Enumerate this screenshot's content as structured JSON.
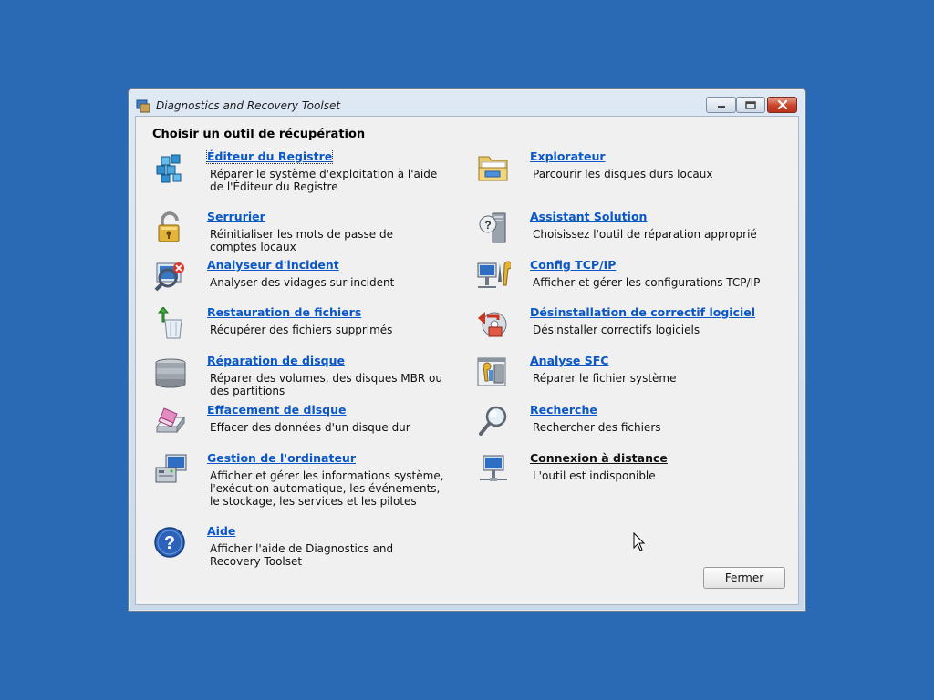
{
  "window": {
    "title": "Diagnostics and Recovery Toolset"
  },
  "heading": "Choisir un outil de récupération",
  "tools_left": [
    {
      "label": "Éditeur du Registre",
      "desc": "Réparer le système d'exploitation à l'aide de l'Éditeur du Registre",
      "icon": "registry-cubes-icon"
    },
    {
      "label": "Serrurier",
      "desc": "Réinitialiser les mots de passe de comptes locaux",
      "icon": "padlock-icon"
    },
    {
      "label": "Analyseur d'incident",
      "desc": "Analyser des vidages sur incident",
      "icon": "crash-analyzer-icon"
    },
    {
      "label": "Restauration de fichiers",
      "desc": "Récupérer des fichiers supprimés",
      "icon": "recycle-bin-icon"
    },
    {
      "label": "Réparation de disque",
      "desc": "Réparer des volumes, des disques MBR ou des partitions",
      "icon": "disk-stack-icon"
    },
    {
      "label": "Effacement de disque",
      "desc": "Effacer des données d'un disque dur",
      "icon": "eraser-icon"
    },
    {
      "label": "Gestion de l'ordinateur",
      "desc": "Afficher et gérer les informations système, l'exécution automatique, les événements, le stockage, les services et les pilotes",
      "icon": "computer-management-icon"
    },
    {
      "label": "Aide",
      "desc": "Afficher l'aide de Diagnostics and Recovery Toolset",
      "icon": "help-icon"
    }
  ],
  "tools_right": [
    {
      "label": "Explorateur",
      "desc": "Parcourir les disques durs locaux",
      "icon": "folder-icon"
    },
    {
      "label": "Assistant Solution",
      "desc": "Choisissez l'outil de réparation approprié",
      "icon": "solution-wizard-icon"
    },
    {
      "label": "Config TCP/IP",
      "desc": "Afficher et gérer les configurations TCP/IP",
      "icon": "network-config-icon"
    },
    {
      "label": "Désinstallation de correctif logiciel",
      "desc": "Désinstaller correctifs logiciels",
      "icon": "hotfix-uninstall-icon"
    },
    {
      "label": "Analyse SFC",
      "desc": "Réparer le fichier système",
      "icon": "sfc-scan-icon"
    },
    {
      "label": "Recherche",
      "desc": "Rechercher des fichiers",
      "icon": "magnifier-icon"
    },
    {
      "label": "Connexion à distance",
      "desc": "L'outil est indisponible",
      "icon": "remote-connection-icon"
    }
  ],
  "close_button_label": "Fermer",
  "colors": {
    "desktop": "#2a69b3",
    "link": "#0a57c8",
    "client": "#f0f0f0"
  }
}
